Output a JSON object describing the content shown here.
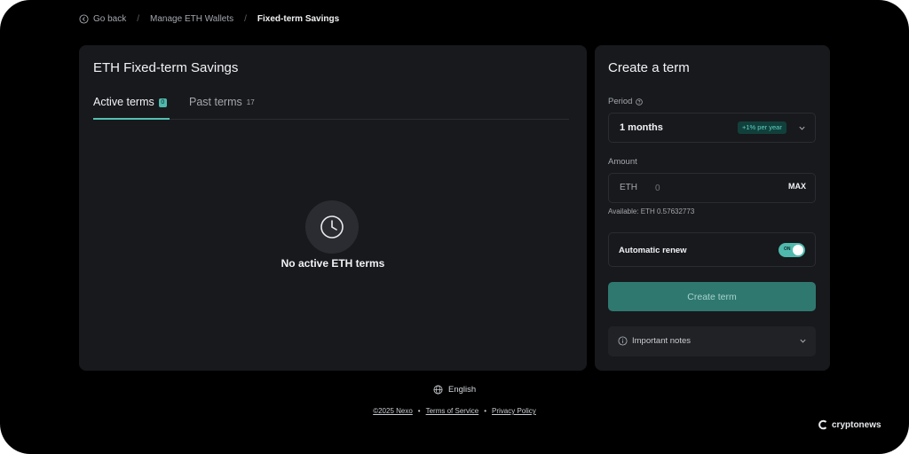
{
  "breadcrumb": {
    "back": "Go back",
    "parent": "Manage ETH Wallets",
    "current": "Fixed-term Savings",
    "separator": "/"
  },
  "left_panel": {
    "title": "ETH Fixed-term Savings",
    "tabs": [
      {
        "label": "Active terms",
        "count": "0",
        "active": true
      },
      {
        "label": "Past terms",
        "count": "17",
        "active": false
      }
    ],
    "empty_message": "No active ETH terms",
    "empty_icon": "clock-icon"
  },
  "right_panel": {
    "title": "Create a term",
    "period_label": "Period",
    "period_value": "1 months",
    "rate_badge": "+1% per year",
    "amount_label": "Amount",
    "amount_currency": "ETH",
    "amount_placeholder": "0",
    "max_label": "MAX",
    "available_label": "Available:",
    "available_value": "ETH 0.57632773",
    "auto_renew_label": "Automatic renew",
    "auto_renew_state": "ON",
    "create_button": "Create term",
    "important_notes": "Important notes"
  },
  "footer": {
    "language": "English",
    "copyright": "©2025 Nexo",
    "terms": "Terms of Service",
    "privacy": "Privacy Policy"
  },
  "watermark": "cryptonews",
  "colors": {
    "background": "#000000",
    "panel": "#18191c",
    "accent": "#4fb9ad",
    "button": "#2f7870"
  }
}
